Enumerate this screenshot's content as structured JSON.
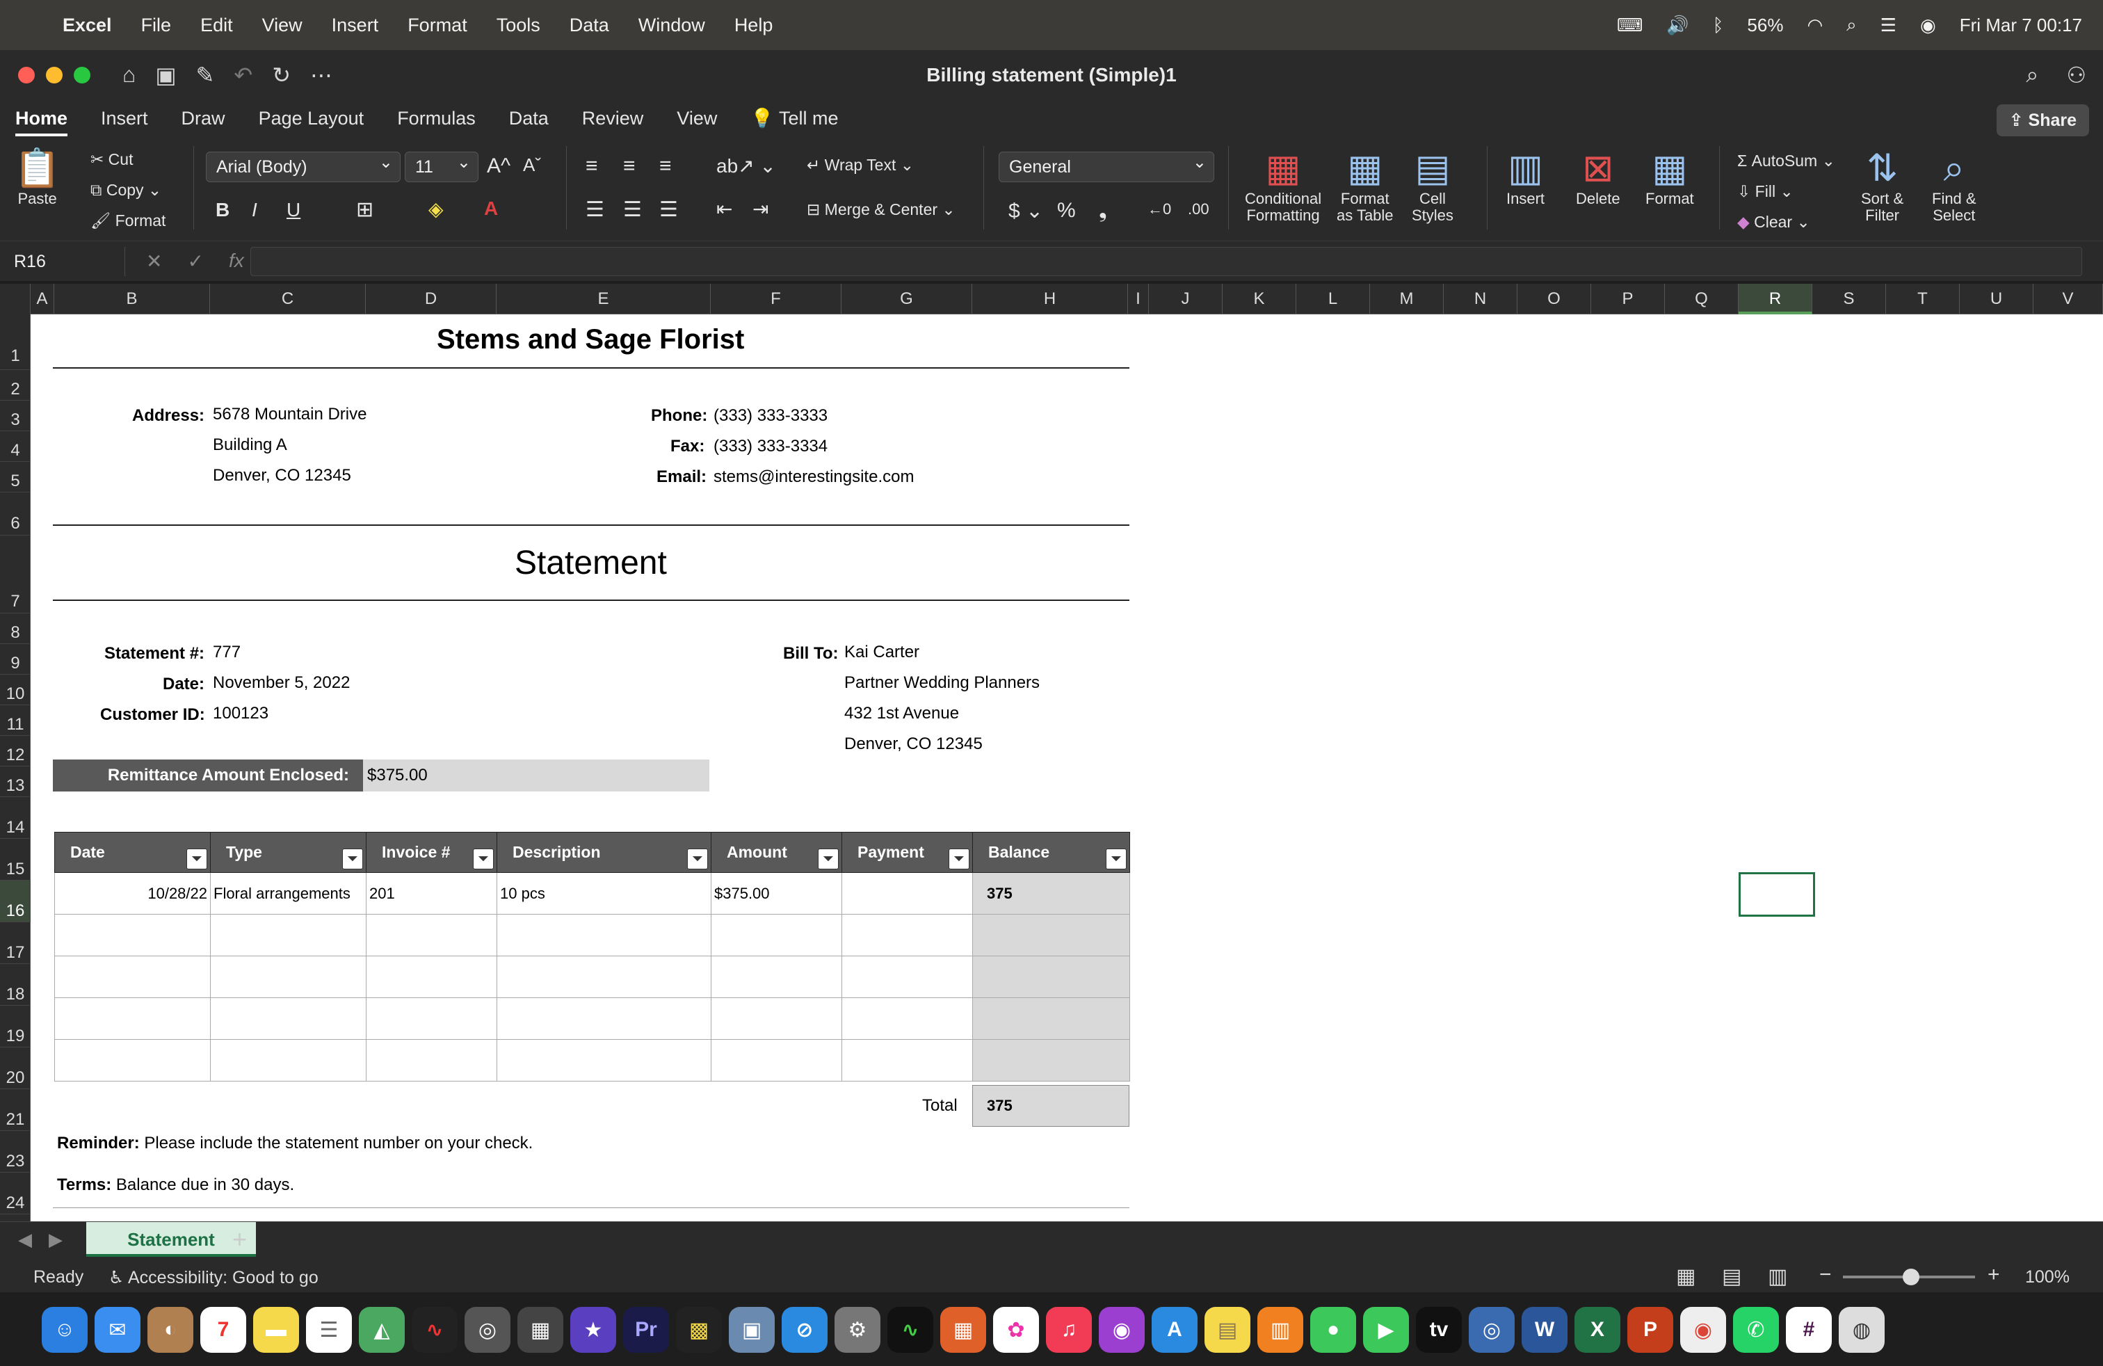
{
  "menubar": {
    "apple": "",
    "items": [
      "Excel",
      "File",
      "Edit",
      "View",
      "Insert",
      "Format",
      "Tools",
      "Data",
      "Window",
      "Help"
    ],
    "battery": "56%",
    "datetime": "Fri Mar 7  00:17"
  },
  "window": {
    "title": "Billing statement (Simple)1"
  },
  "ribbon_tabs": [
    "Home",
    "Insert",
    "Draw",
    "Page Layout",
    "Formulas",
    "Data",
    "Review",
    "View",
    "Tell me"
  ],
  "share_label": "Share",
  "ribbon": {
    "paste": "Paste",
    "cut": "Cut",
    "copy": "Copy",
    "format": "Format",
    "font_name": "Arial (Body)",
    "font_size": "11",
    "wrap_text": "Wrap Text",
    "merge_center": "Merge & Center",
    "number_format": "General",
    "conditional_formatting": [
      "Conditional",
      "Formatting"
    ],
    "format_as_table": [
      "Format",
      "as Table"
    ],
    "cell_styles": [
      "Cell",
      "Styles"
    ],
    "insert": "Insert",
    "delete": "Delete",
    "format_cells": "Format",
    "autosum": "AutoSum",
    "fill": "Fill",
    "clear": "Clear",
    "sort_filter": [
      "Sort &",
      "Filter"
    ],
    "find_select": [
      "Find &",
      "Select"
    ]
  },
  "formula_bar": {
    "name_box": "R16",
    "formula": ""
  },
  "columns": [
    "A",
    "B",
    "C",
    "D",
    "E",
    "F",
    "G",
    "H",
    "I",
    "J",
    "K",
    "L",
    "M",
    "N",
    "O",
    "P",
    "Q",
    "R",
    "S",
    "T",
    "U",
    "V"
  ],
  "rows": [
    "1",
    "2",
    "3",
    "4",
    "5",
    "6",
    "7",
    "8",
    "9",
    "10",
    "11",
    "12",
    "13",
    "14",
    "15",
    "16",
    "17",
    "18",
    "19",
    "20",
    "21",
    "23",
    "24"
  ],
  "doc": {
    "company": "Stems and Sage Florist",
    "address_label": "Address:",
    "address": [
      "5678 Mountain Drive",
      "Building A",
      "Denver, CO 12345"
    ],
    "phone_label": "Phone:",
    "phone": "(333) 333-3333",
    "fax_label": "Fax:",
    "fax": "(333) 333-3334",
    "email_label": "Email:",
    "email": "stems@interestingsite.com",
    "statement_title": "Statement",
    "statement_no_label": "Statement #:",
    "statement_no": "777",
    "date_label": "Date:",
    "date": "November 5, 2022",
    "customer_id_label": "Customer ID:",
    "customer_id": "100123",
    "bill_to_label": "Bill To:",
    "bill_to": [
      "Kai Carter",
      "Partner Wedding Planners",
      "432 1st Avenue",
      "Denver, CO 12345"
    ],
    "remittance_label": "Remittance Amount Enclosed:",
    "remittance_value": "$375.00",
    "table_headers": [
      "Date",
      "Type",
      "Invoice #",
      "Description",
      "Amount",
      "Payment",
      "Balance"
    ],
    "table_rows": [
      [
        "10/28/22",
        "Floral arrangements",
        "201",
        "10 pcs",
        "$375.00",
        "",
        "375"
      ],
      [
        "",
        "",
        "",
        "",
        "",
        "",
        ""
      ],
      [
        "",
        "",
        "",
        "",
        "",
        "",
        ""
      ],
      [
        "",
        "",
        "",
        "",
        "",
        "",
        ""
      ],
      [
        "",
        "",
        "",
        "",
        "",
        "",
        ""
      ]
    ],
    "total_label": "Total",
    "total_value": "375",
    "reminder_label": "Reminder:",
    "reminder_text": "Please include the statement number on your check.",
    "terms_label": "Terms:",
    "terms_text": "Balance due in 30 days."
  },
  "sheet_tab": "Statement",
  "status": {
    "ready": "Ready",
    "accessibility": "Accessibility: Good to go",
    "zoom": "100%"
  },
  "colors": {
    "excel_green": "#217346",
    "header_dark": "#595959",
    "balance_gray": "#d9d9d9"
  }
}
